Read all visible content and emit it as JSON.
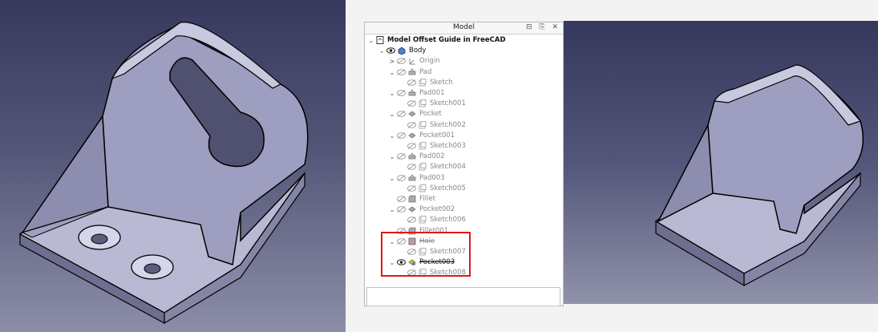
{
  "panel": {
    "title": "Model",
    "buttons": "⊟ ⎘ ✕"
  },
  "tree": [
    {
      "label": "Model Offset Guide in FreeCAD",
      "depth": 0,
      "chev": "⌄",
      "eye": false,
      "icon": "document-icon",
      "style": "bold"
    },
    {
      "label": "Body",
      "depth": 1,
      "chev": "⌄",
      "eye": "visible",
      "icon": "body-icon",
      "style": "dark"
    },
    {
      "label": "Origin",
      "depth": 2,
      "chev": ">",
      "eye": "hidden",
      "icon": "origin-icon",
      "style": "grey"
    },
    {
      "label": "Pad",
      "depth": 2,
      "chev": "⌄",
      "eye": "hidden",
      "icon": "pad-icon",
      "style": "grey"
    },
    {
      "label": "Sketch",
      "depth": 3,
      "chev": "",
      "eye": "hidden",
      "icon": "sketch-icon",
      "style": "grey"
    },
    {
      "label": "Pad001",
      "depth": 2,
      "chev": "⌄",
      "eye": "hidden",
      "icon": "pad-icon",
      "style": "grey"
    },
    {
      "label": "Sketch001",
      "depth": 3,
      "chev": "",
      "eye": "hidden",
      "icon": "sketch-icon",
      "style": "grey"
    },
    {
      "label": "Pocket",
      "depth": 2,
      "chev": "⌄",
      "eye": "hidden",
      "icon": "pocket-icon",
      "style": "grey"
    },
    {
      "label": "Sketch002",
      "depth": 3,
      "chev": "",
      "eye": "hidden",
      "icon": "sketch-icon",
      "style": "grey"
    },
    {
      "label": "Pocket001",
      "depth": 2,
      "chev": "⌄",
      "eye": "hidden",
      "icon": "pocket-icon",
      "style": "grey"
    },
    {
      "label": "Sketch003",
      "depth": 3,
      "chev": "",
      "eye": "hidden",
      "icon": "sketch-icon",
      "style": "grey"
    },
    {
      "label": "Pad002",
      "depth": 2,
      "chev": "⌄",
      "eye": "hidden",
      "icon": "pad-icon",
      "style": "grey"
    },
    {
      "label": "Sketch004",
      "depth": 3,
      "chev": "",
      "eye": "hidden",
      "icon": "sketch-icon",
      "style": "grey"
    },
    {
      "label": "Pad003",
      "depth": 2,
      "chev": "⌄",
      "eye": "hidden",
      "icon": "pad-icon",
      "style": "grey"
    },
    {
      "label": "Sketch005",
      "depth": 3,
      "chev": "",
      "eye": "hidden",
      "icon": "sketch-icon",
      "style": "grey"
    },
    {
      "label": "Fillet",
      "depth": 2,
      "chev": "",
      "eye": "hidden",
      "icon": "fillet-icon",
      "style": "grey"
    },
    {
      "label": "Pocket002",
      "depth": 2,
      "chev": "⌄",
      "eye": "hidden",
      "icon": "pocket-icon",
      "style": "grey"
    },
    {
      "label": "Sketch006",
      "depth": 3,
      "chev": "",
      "eye": "hidden",
      "icon": "sketch-icon",
      "style": "grey"
    },
    {
      "label": "Fillet001",
      "depth": 2,
      "chev": "",
      "eye": "hidden",
      "icon": "fillet-icon",
      "style": "grey"
    },
    {
      "label": "Hole",
      "depth": 2,
      "chev": "⌄",
      "eye": "hidden",
      "icon": "hole-icon",
      "style": "strike"
    },
    {
      "label": "Sketch007",
      "depth": 3,
      "chev": "",
      "eye": "hidden",
      "icon": "sketch-icon",
      "style": "grey"
    },
    {
      "label": "Pocket003",
      "depth": 2,
      "chev": "⌄",
      "eye": "visible",
      "icon": "pocket-active-icon",
      "style": "strike-dark"
    },
    {
      "label": "Sketch008",
      "depth": 3,
      "chev": "",
      "eye": "hidden",
      "icon": "sketch-icon",
      "style": "grey"
    }
  ],
  "colors": {
    "highlight": "#e01818",
    "part_face": "#a9a9c8",
    "part_dark": "#6b6b8a",
    "part_shadow": "#4a4a66"
  }
}
